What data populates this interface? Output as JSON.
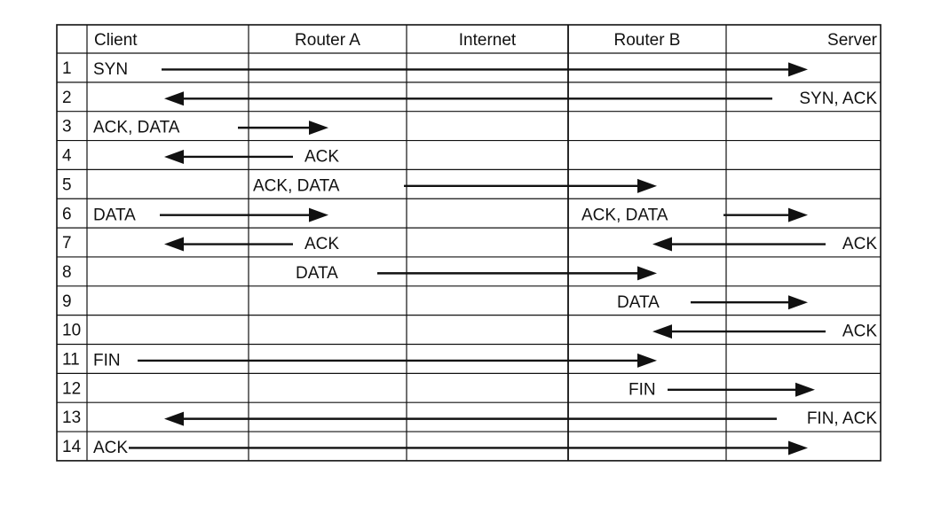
{
  "columns": [
    "",
    "Client",
    "Router A",
    "Internet",
    "Router B",
    "Server"
  ],
  "rows": [
    {
      "num": "1",
      "messages": [
        {
          "label": "SYN",
          "direction": "right"
        }
      ]
    },
    {
      "num": "2",
      "messages": [
        {
          "label": "SYN, ACK",
          "direction": "left"
        }
      ]
    },
    {
      "num": "3",
      "messages": [
        {
          "label": "ACK, DATA",
          "direction": "right"
        }
      ]
    },
    {
      "num": "4",
      "messages": [
        {
          "label": "ACK",
          "direction": "left"
        }
      ]
    },
    {
      "num": "5",
      "messages": [
        {
          "label": "ACK, DATA",
          "direction": "right"
        }
      ]
    },
    {
      "num": "6",
      "messages": [
        {
          "label": "DATA",
          "direction": "right"
        },
        {
          "label": "ACK, DATA",
          "direction": "right"
        }
      ]
    },
    {
      "num": "7",
      "messages": [
        {
          "label": "ACK",
          "direction": "left"
        },
        {
          "label": "ACK",
          "direction": "left"
        }
      ]
    },
    {
      "num": "8",
      "messages": [
        {
          "label": "DATA",
          "direction": "right"
        }
      ]
    },
    {
      "num": "9",
      "messages": [
        {
          "label": "DATA",
          "direction": "right"
        }
      ]
    },
    {
      "num": "10",
      "messages": [
        {
          "label": "ACK",
          "direction": "left"
        }
      ]
    },
    {
      "num": "11",
      "messages": [
        {
          "label": "FIN",
          "direction": "right"
        }
      ]
    },
    {
      "num": "12",
      "messages": [
        {
          "label": "FIN",
          "direction": "right"
        }
      ]
    },
    {
      "num": "13",
      "messages": [
        {
          "label": "FIN, ACK",
          "direction": "left"
        }
      ]
    },
    {
      "num": "14",
      "messages": [
        {
          "label": "ACK",
          "direction": "right"
        }
      ]
    }
  ],
  "colors": {
    "ink": "#111111",
    "background": "#ffffff"
  }
}
